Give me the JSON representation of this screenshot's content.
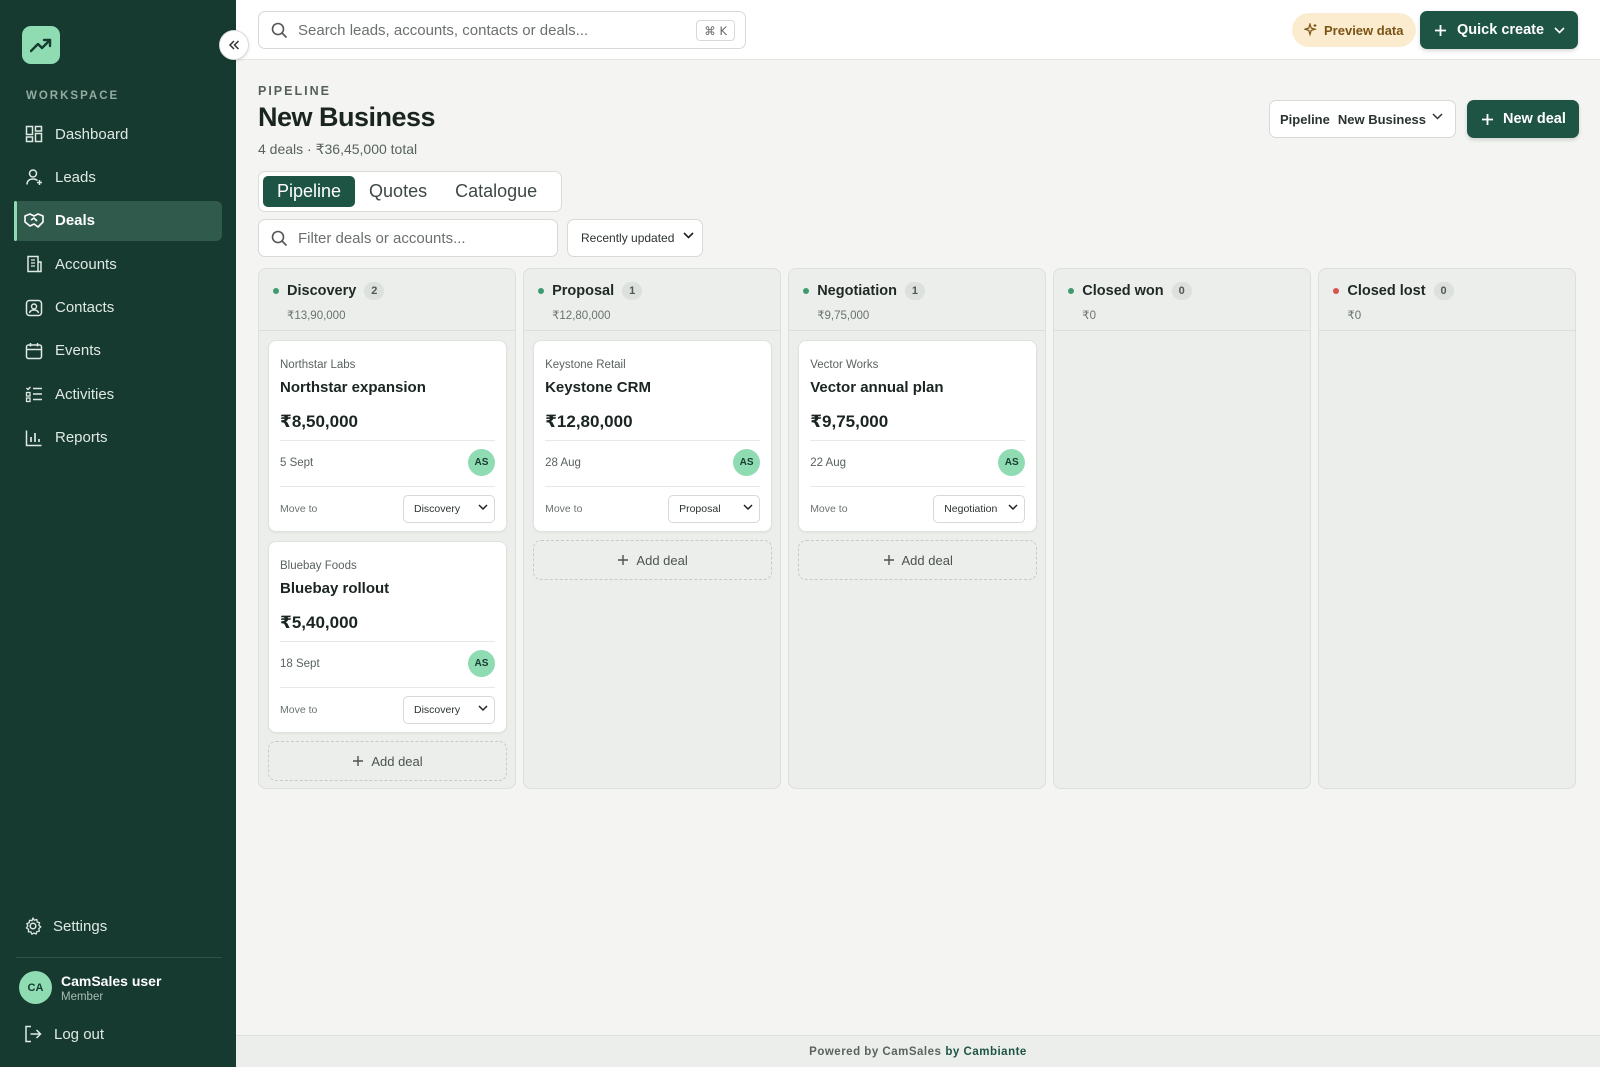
{
  "sidebar": {
    "workspace_label": "WORKSPACE",
    "items": [
      {
        "label": "Dashboard",
        "icon": "dashboard-icon"
      },
      {
        "label": "Leads",
        "icon": "user-plus-icon"
      },
      {
        "label": "Deals",
        "icon": "handshake-icon",
        "active": true
      },
      {
        "label": "Accounts",
        "icon": "building-icon"
      },
      {
        "label": "Contacts",
        "icon": "contact-card-icon"
      },
      {
        "label": "Events",
        "icon": "calendar-icon"
      },
      {
        "label": "Activities",
        "icon": "checklist-icon"
      },
      {
        "label": "Reports",
        "icon": "bar-chart-icon"
      }
    ],
    "settings_label": "Settings",
    "user": {
      "initials": "CA",
      "name": "CamSales user",
      "role": "Member"
    },
    "logout_label": "Log out"
  },
  "topbar": {
    "search_placeholder": "Search leads, accounts, contacts or deals...",
    "shortcut": "⌘ K",
    "preview_label": "Preview data",
    "quick_create_label": "Quick create"
  },
  "header": {
    "eyebrow": "PIPELINE",
    "title": "New Business",
    "subtitle": "4 deals · ₹36,45,000 total",
    "pipeline_select_label": "Pipeline",
    "pipeline_select_value": "New Business",
    "new_deal_label": "New deal"
  },
  "tabs": [
    "Pipeline",
    "Quotes",
    "Catalogue"
  ],
  "filters": {
    "placeholder": "Filter deals or accounts...",
    "sort_value": "Recently updated"
  },
  "columns": [
    {
      "name": "Discovery",
      "count": "2",
      "total": "₹13,90,000",
      "dot_color": "#3f9a6e"
    },
    {
      "name": "Proposal",
      "count": "1",
      "total": "₹12,80,000",
      "dot_color": "#3f9a6e"
    },
    {
      "name": "Negotiation",
      "count": "1",
      "total": "₹9,75,000",
      "dot_color": "#3f9a6e"
    },
    {
      "name": "Closed won",
      "count": "0",
      "total": "₹0",
      "dot_color": "#3f9a6e"
    },
    {
      "name": "Closed lost",
      "count": "0",
      "total": "₹0",
      "dot_color": "#d9534f"
    }
  ],
  "deals": [
    {
      "column": 0,
      "company": "Northstar Labs",
      "title": "Northstar expansion",
      "amount": "₹8,50,000",
      "date": "5 Sept",
      "owner": "AS",
      "move_label": "Move to",
      "stage": "Discovery"
    },
    {
      "column": 0,
      "company": "Bluebay Foods",
      "title": "Bluebay rollout",
      "amount": "₹5,40,000",
      "date": "18 Sept",
      "owner": "AS",
      "move_label": "Move to",
      "stage": "Discovery"
    },
    {
      "column": 1,
      "company": "Keystone Retail",
      "title": "Keystone CRM",
      "amount": "₹12,80,000",
      "date": "28 Aug",
      "owner": "AS",
      "move_label": "Move to",
      "stage": "Proposal"
    },
    {
      "column": 2,
      "company": "Vector Works",
      "title": "Vector annual plan",
      "amount": "₹9,75,000",
      "date": "22 Aug",
      "owner": "AS",
      "move_label": "Move to",
      "stage": "Negotiation"
    }
  ],
  "add_deal_label": "Add deal",
  "footer": {
    "text": "Powered by CamSales",
    "brand": "by Cambiante"
  },
  "colors": {
    "sidebar": "#173a30",
    "accent": "#1d5443",
    "mint": "#8fdcb3"
  }
}
